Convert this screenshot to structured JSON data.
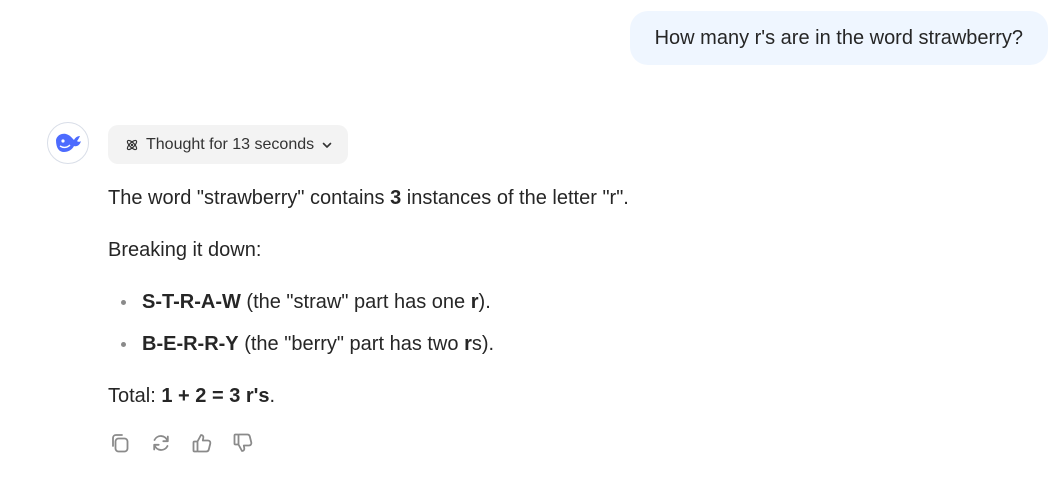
{
  "user_message": "How many r's are in the word strawberry?",
  "assistant": {
    "avatar_icon": "whale-logo-icon",
    "brand_color": "#4d6bfe",
    "thought_label": "Thought for 13 seconds",
    "answer": {
      "p1": {
        "before": "The word \"strawberry\" contains ",
        "bold": "3",
        "after": " instances of the letter \"r\"."
      },
      "p2": "Breaking it down:",
      "bullets": [
        {
          "bold": "S-T-R-A-W",
          "text": " (the \"straw\" part has one ",
          "bold2": "r",
          "tail": ")."
        },
        {
          "bold": "B-E-R-R-Y",
          "text": " (the \"berry\" part has two ",
          "bold2": "r",
          "tail": "s)."
        }
      ],
      "total": {
        "label": "Total: ",
        "bold": "1 + 2 = 3 r's",
        "after": "."
      }
    },
    "actions": [
      "copy-icon",
      "regenerate-icon",
      "thumbs-up-icon",
      "thumbs-down-icon"
    ]
  }
}
